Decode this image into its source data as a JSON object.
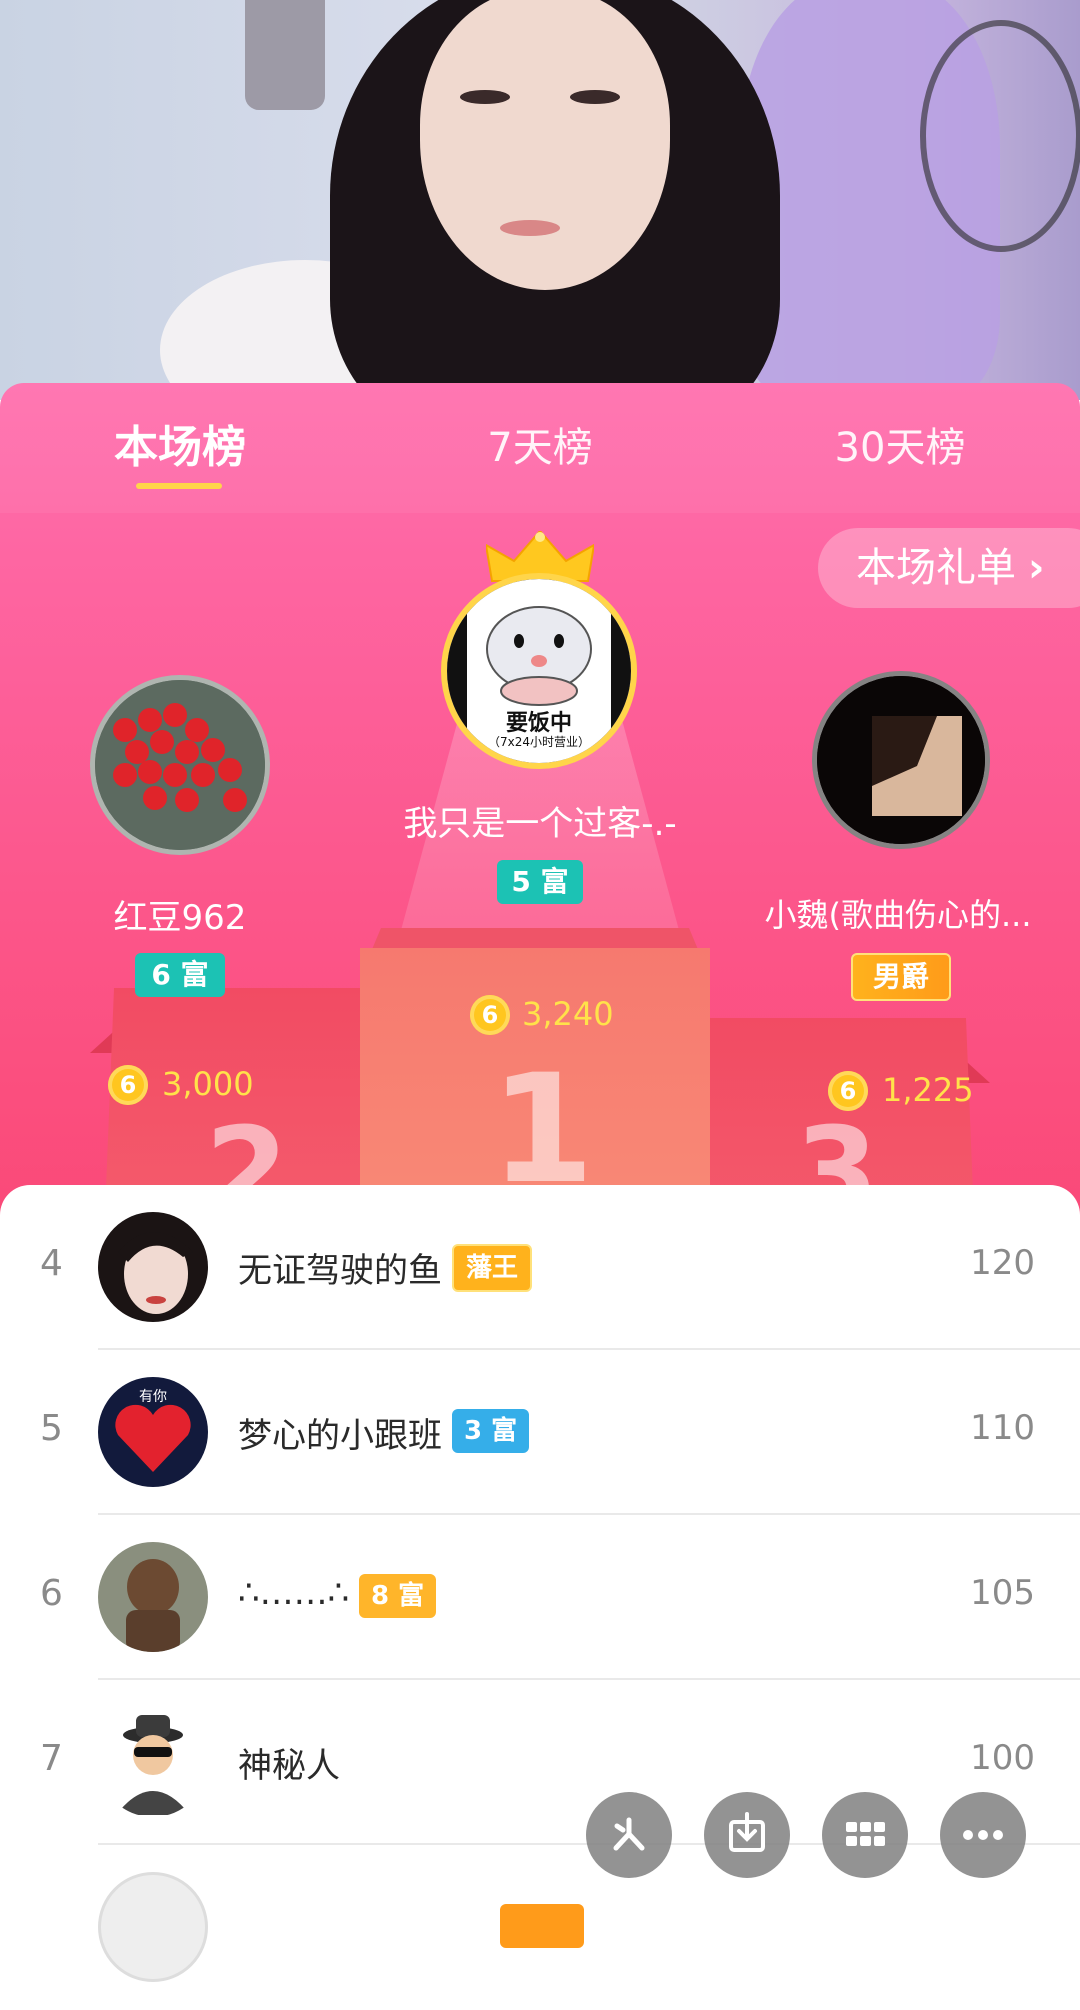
{
  "tabs": [
    {
      "label": "本场榜",
      "active": true
    },
    {
      "label": "7天榜",
      "active": false
    },
    {
      "label": "30天榜",
      "active": false
    }
  ],
  "gift_list_button": {
    "label": "本场礼单",
    "icon": "chevron-right-icon"
  },
  "podium": {
    "first": {
      "rank": 1,
      "avatar_text": "要饭中",
      "avatar_subtext": "（7x24小时营业）",
      "name": "我只是一个过客-.-",
      "badge": "5 富",
      "score": "3,240",
      "coin_symbol": "6"
    },
    "second": {
      "rank": 2,
      "name": "红豆962",
      "badge": "6 富",
      "score": "3,000",
      "coin_symbol": "6"
    },
    "third": {
      "rank": 3,
      "name": "小魏(歌曲伤心的...",
      "badge": "男爵",
      "score": "1,225",
      "coin_symbol": "6"
    }
  },
  "list": [
    {
      "rank": "4",
      "name": "无证驾驶的鱼",
      "badge": "藩王",
      "badge_color": "#ffb21c",
      "value": "120"
    },
    {
      "rank": "5",
      "name": "梦心的小跟班",
      "badge": "3 富",
      "badge_color": "#35aee9",
      "value": "110"
    },
    {
      "rank": "6",
      "name": "∴……∴",
      "badge": "8 富",
      "badge_color": "#ffb52a",
      "value": "105"
    },
    {
      "rank": "7",
      "name": "神秘人",
      "badge": "",
      "badge_color": "",
      "value": "100"
    }
  ],
  "avatar_texts": {
    "row5": "有你"
  },
  "fab_icons": [
    "share-icon",
    "download-icon",
    "grid-icon",
    "more-icon"
  ],
  "colors": {
    "sheet_pink": "#fd5f99",
    "accent_yellow": "#ffd54a",
    "score_yellow": "#ffe24a",
    "teal_badge": "#1cc2b4"
  }
}
